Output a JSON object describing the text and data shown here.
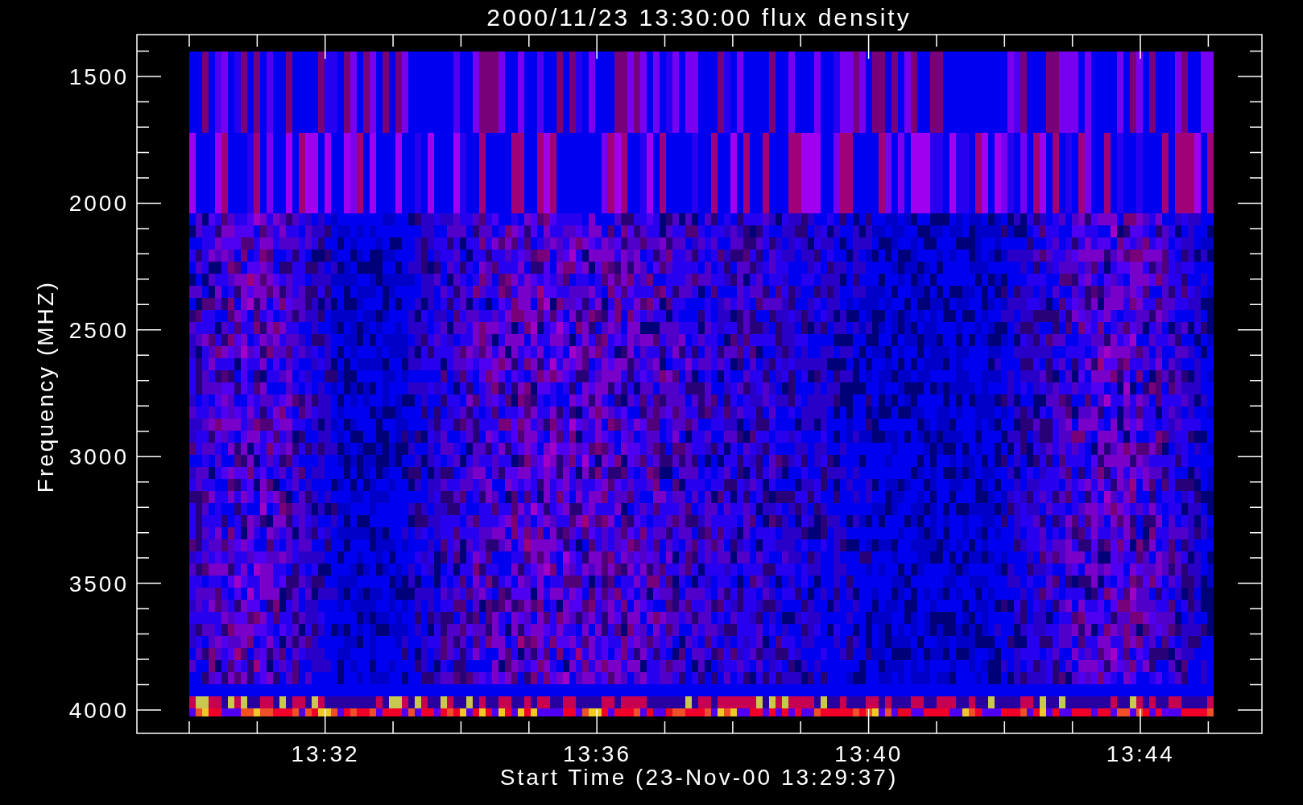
{
  "plot": {
    "title": "2000/11/23 13:30:00 flux density",
    "ylabel": "Frequency (MHZ)",
    "xlabel": "Start Time (23-Nov-00 13:29:37)",
    "yticks": [
      "1500",
      "2000",
      "2500",
      "3000",
      "3500",
      "4000"
    ],
    "xticks": [
      "13:32",
      "13:36",
      "13:40",
      "13:44"
    ]
  }
}
